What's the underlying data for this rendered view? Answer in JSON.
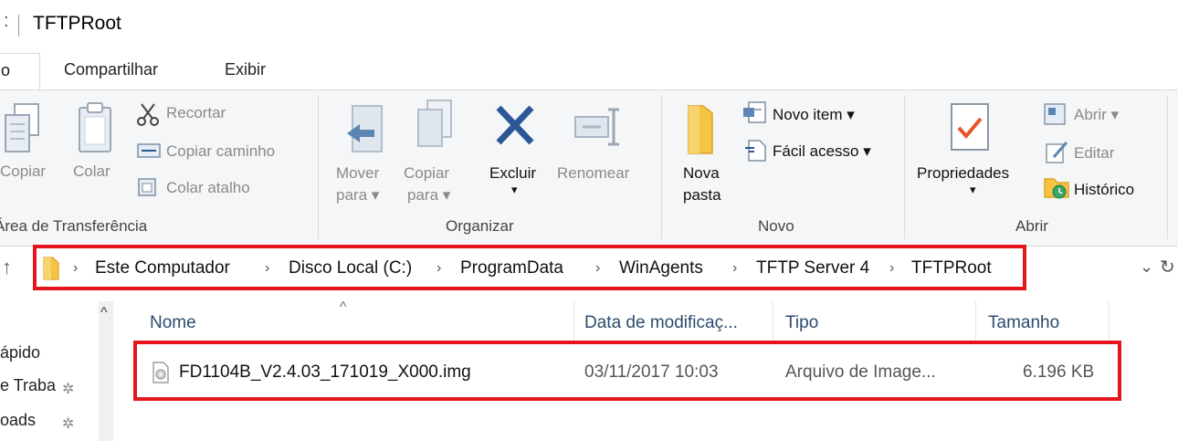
{
  "window": {
    "title_prefix": ":",
    "title": "TFTPRoot"
  },
  "tabs": [
    {
      "label": "o"
    },
    {
      "label": "Compartilhar"
    },
    {
      "label": "Exibir"
    }
  ],
  "ribbon": {
    "clipboard": {
      "copy": "Copiar",
      "paste": "Colar",
      "cut": "Recortar",
      "copy_path": "Copiar caminho",
      "paste_shortcut": "Colar atalho",
      "group_label": "Área de Transferência"
    },
    "organize": {
      "move_to_l1": "Mover",
      "move_to_l2": "para ▾",
      "copy_to_l1": "Copiar",
      "copy_to_l2": "para ▾",
      "delete": "Excluir",
      "delete_arrow": "▾",
      "rename": "Renomear",
      "group_label": "Organizar"
    },
    "new": {
      "new_folder_l1": "Nova",
      "new_folder_l2": "pasta",
      "new_item": "Novo item ▾",
      "easy_access": "Fácil acesso ▾",
      "group_label": "Novo"
    },
    "open": {
      "properties": "Propriedades",
      "properties_arrow": "▾",
      "open": "Abrir ▾",
      "edit": "Editar",
      "history": "Histórico",
      "group_label": "Abrir"
    }
  },
  "address_bar": {
    "segments": [
      "Este Computador",
      "Disco Local (C:)",
      "ProgramData",
      "WinAgents",
      "TFTP Server 4",
      "TFTPRoot"
    ],
    "chevron": "›",
    "dropdown": "⌄",
    "refresh": "↻",
    "up": "↑"
  },
  "nav": {
    "items": [
      {
        "label": "ápido"
      },
      {
        "label": "e Traba"
      },
      {
        "label": "oads"
      }
    ],
    "scroll_up": "^"
  },
  "file_list": {
    "sort_indicator": "^",
    "columns": {
      "name": "Nome",
      "date": "Data de modificaç...",
      "type": "Tipo",
      "size": "Tamanho"
    },
    "rows": [
      {
        "name": "FD1104B_V2.4.03_171019_X000.img",
        "date": "03/11/2017 10:03",
        "type": "Arquivo de Image...",
        "size": "6.196 KB"
      }
    ]
  },
  "colors": {
    "highlight": "#e4161d",
    "folder": "#f6c342",
    "delete_x": "#2b5797",
    "properties_check": "#e8532a"
  }
}
